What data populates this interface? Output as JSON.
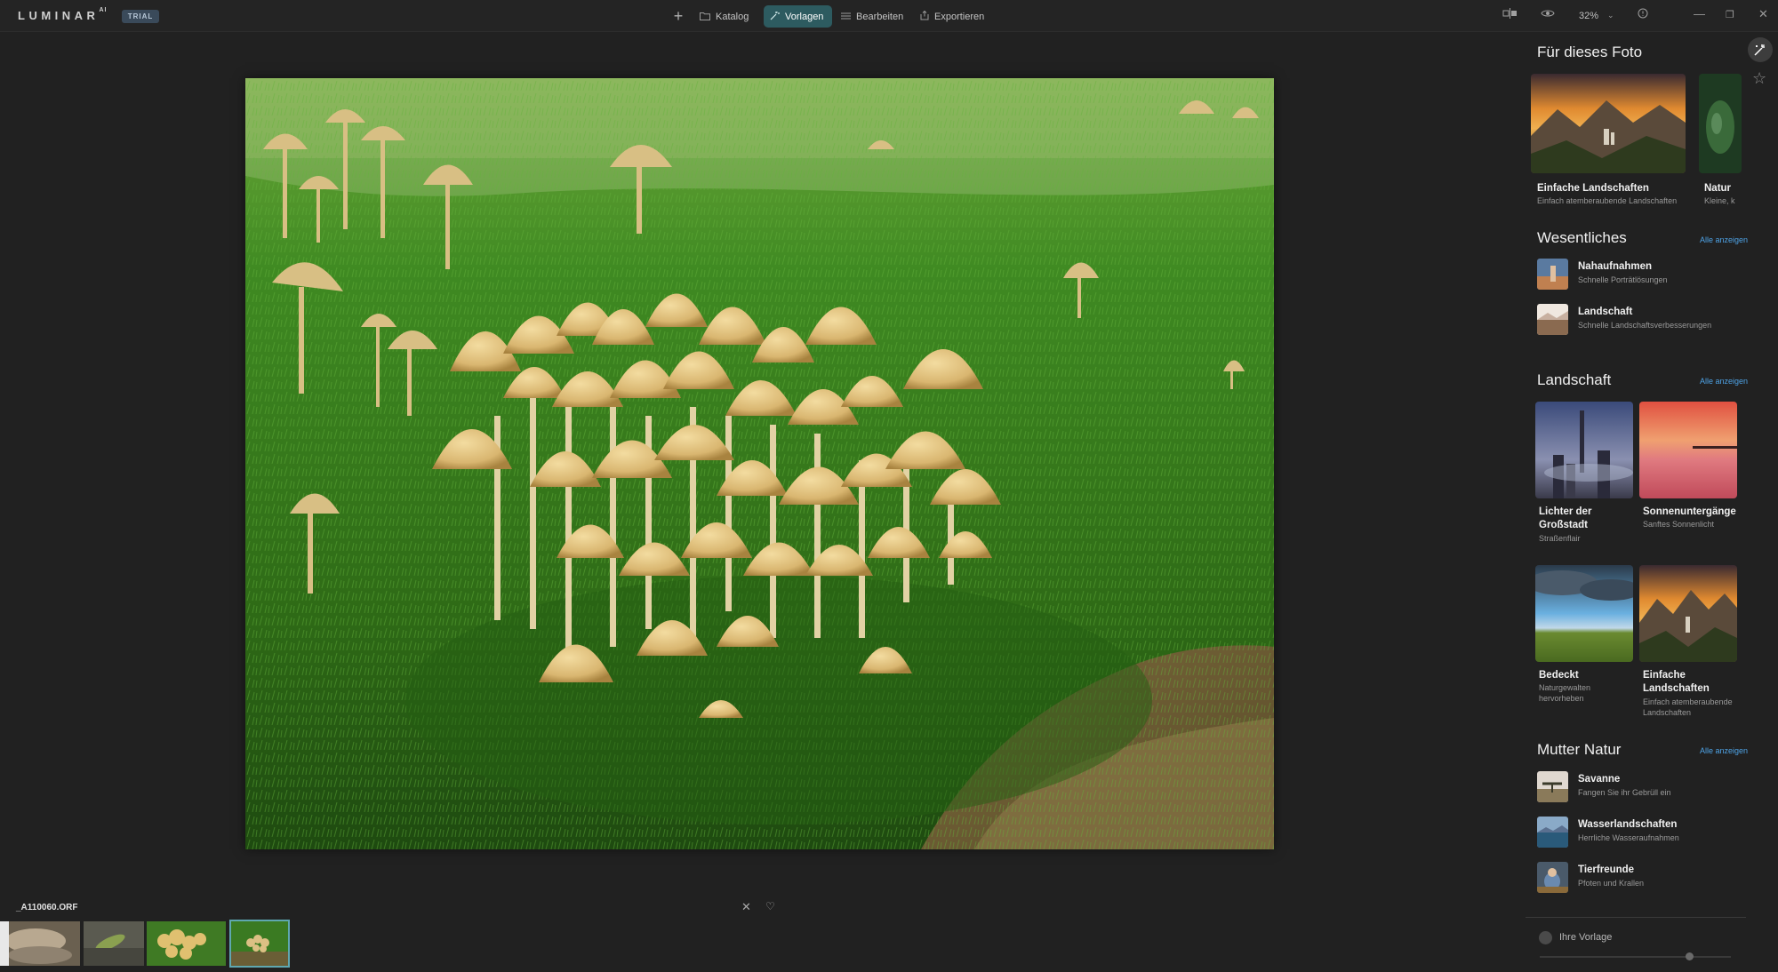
{
  "app": {
    "logo": "LUMINAR",
    "logo_sup": "AI",
    "trial_badge": "TRIAL"
  },
  "nav": {
    "add_glyph": "+",
    "katalog": "Katalog",
    "vorlagen": "Vorlagen",
    "bearbeiten": "Bearbeiten",
    "exportieren": "Exportieren"
  },
  "toolbar": {
    "zoom": "32%"
  },
  "filmstrip": {
    "filename": "_A110060.ORF"
  },
  "panel": {
    "for_photo": {
      "title": "Für dieses Foto",
      "cards": [
        {
          "title": "Einfache Landschaften",
          "sub": "Einfach atemberaubende Landschaften"
        },
        {
          "title": "Natur",
          "sub": "Kleine, k"
        }
      ]
    },
    "wesentliches": {
      "title": "Wesentliches",
      "show_all": "Alle anzeigen",
      "items": [
        {
          "title": "Nahaufnahmen",
          "sub": "Schnelle Porträtlösungen"
        },
        {
          "title": "Landschaft",
          "sub": "Schnelle Landschaftsverbesserungen"
        }
      ]
    },
    "landschaft": {
      "title": "Landschaft",
      "show_all": "Alle anzeigen",
      "cards": [
        {
          "title": "Lichter der Großstadt",
          "sub": "Straßenflair"
        },
        {
          "title": "Sonnenuntergänge",
          "sub": "Sanftes Sonnenlicht"
        },
        {
          "title": "Bedeckt",
          "sub": "Naturgewalten hervorheben"
        },
        {
          "title": "Einfache Landschaften",
          "sub": "Einfach atemberaubende Landschaften"
        }
      ]
    },
    "mutter_natur": {
      "title": "Mutter Natur",
      "show_all": "Alle anzeigen",
      "items": [
        {
          "title": "Savanne",
          "sub": "Fangen Sie ihr Gebrüll ein"
        },
        {
          "title": "Wasserlandschaften",
          "sub": "Herrliche Wasseraufnahmen"
        },
        {
          "title": "Tierfreunde",
          "sub": "Pfoten und Krallen"
        }
      ]
    },
    "ihre_vorlage": {
      "label": "Ihre Vorlage"
    }
  },
  "colors": {
    "accent": "#2d5b60",
    "link": "#4ea3e6",
    "active_thumb": "#5fa7b0"
  }
}
